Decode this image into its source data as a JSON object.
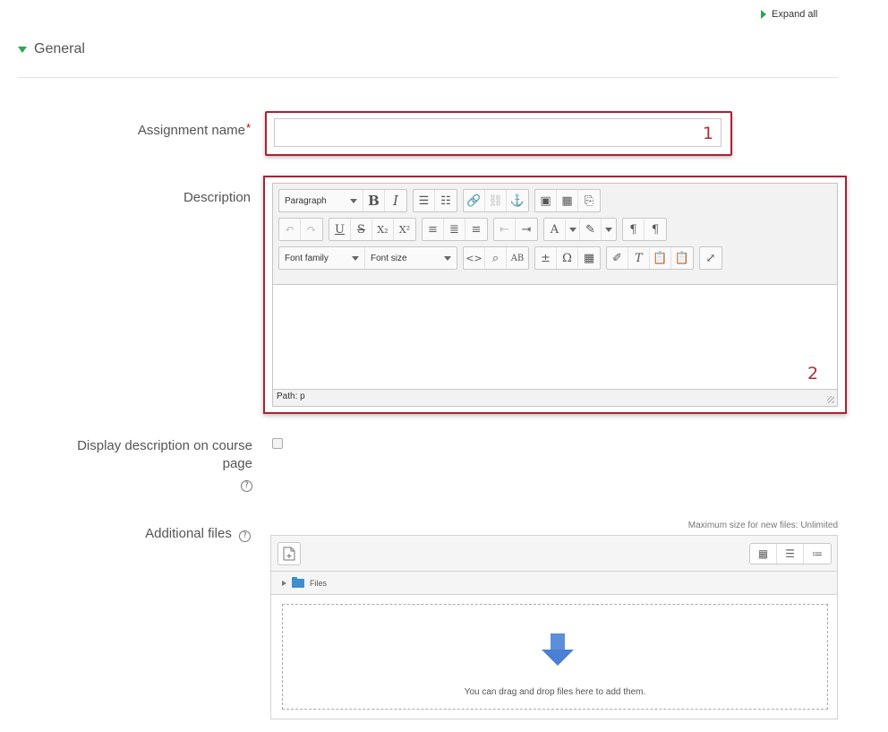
{
  "header": {
    "expand_all": "Expand all"
  },
  "section": {
    "title": "General"
  },
  "fields": {
    "assignment_name": {
      "label": "Assignment name",
      "required_mark": "*",
      "value": ""
    },
    "description": {
      "label": "Description"
    },
    "display_description": {
      "label_line1": "Display description on course",
      "label_line2": "page",
      "checked": false
    },
    "additional_files": {
      "label": "Additional files",
      "max_size": "Maximum size for new files: Unlimited"
    }
  },
  "editor": {
    "paragraph_select": "Paragraph",
    "font_family_select": "Font family",
    "font_size_select": "Font size",
    "status_path": "Path: p"
  },
  "file_manager": {
    "folder_label": "Files",
    "drop_text": "You can drag and drop files here to add them."
  },
  "callouts": {
    "one": "1",
    "two": "2"
  },
  "colors": {
    "accent": "#2ea44f",
    "highlight_border": "#aa2233",
    "required": "#cc0000",
    "drop_arrow": "#4a7fd4"
  }
}
